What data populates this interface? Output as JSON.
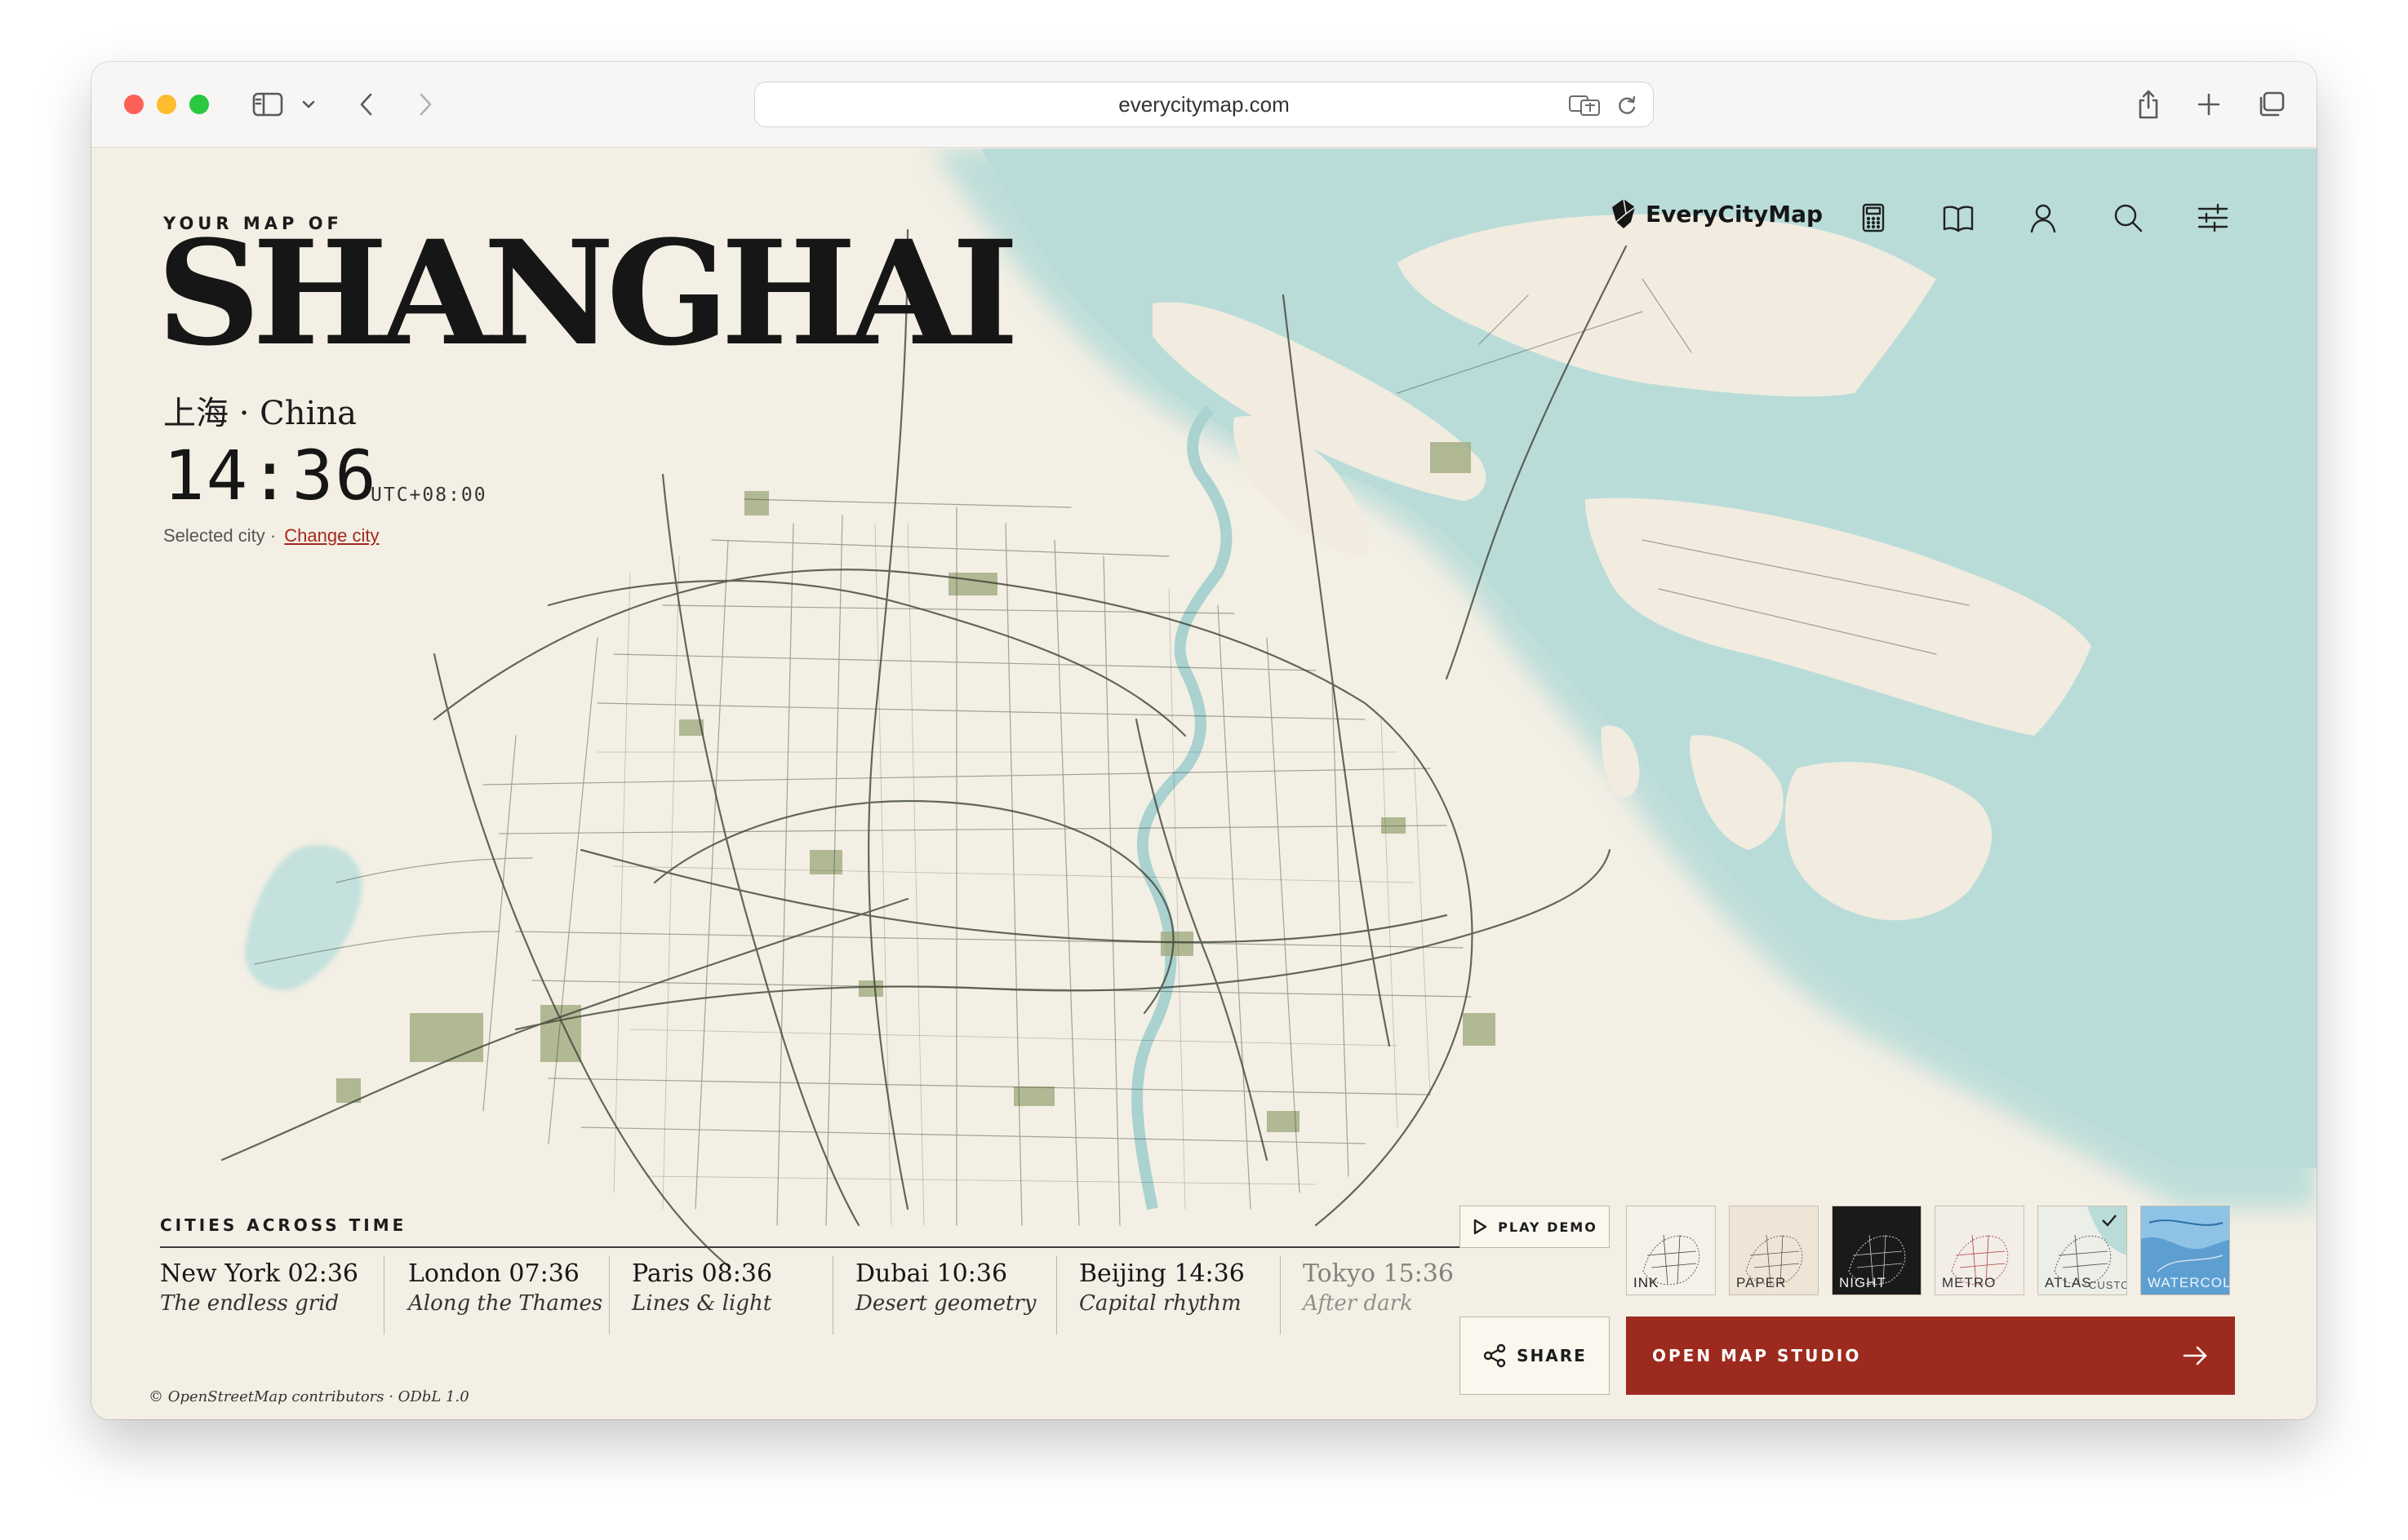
{
  "browser": {
    "url": "everycitymap.com"
  },
  "hero": {
    "kicker": "YOUR MAP OF",
    "city": "SHANGHAI",
    "local_name": "上海 · China",
    "time": "14:36",
    "utc": "UTC+08:00",
    "selected_label": "Selected city ·",
    "change_city": "Change city"
  },
  "header": {
    "brand": "EveryCityMap",
    "icons": [
      "calculator-icon",
      "book-icon",
      "user-icon",
      "search-icon",
      "sliders-icon"
    ]
  },
  "cities_across_time": {
    "title": "CITIES ACROSS TIME",
    "items": [
      {
        "name": "New York 02:36",
        "tagline": "The endless grid"
      },
      {
        "name": "London 07:36",
        "tagline": "Along the Thames"
      },
      {
        "name": "Paris 08:36",
        "tagline": "Lines & light"
      },
      {
        "name": "Dubai 10:36",
        "tagline": "Desert geometry"
      },
      {
        "name": "Beijing 14:36",
        "tagline": "Capital rhythm"
      },
      {
        "name": "Tokyo 15:36",
        "tagline": "After dark"
      }
    ]
  },
  "actions": {
    "play_demo": "PLAY DEMO",
    "share": "SHARE",
    "open_studio": "OPEN MAP STUDIO"
  },
  "styles": [
    {
      "label": "INK"
    },
    {
      "label": "PAPER"
    },
    {
      "label": "NIGHT"
    },
    {
      "label": "METRO"
    },
    {
      "label": "ATLAS",
      "extra": "CUSTO",
      "selected": true
    },
    {
      "label": "WATERCOLO"
    }
  ],
  "attribution": "© OpenStreetMap contributors · ODbL 1.0",
  "colors": {
    "land": "#f3efe4",
    "water": "#b9dcd9",
    "park": "#a5ae86",
    "accent": "#9d2a1e"
  }
}
